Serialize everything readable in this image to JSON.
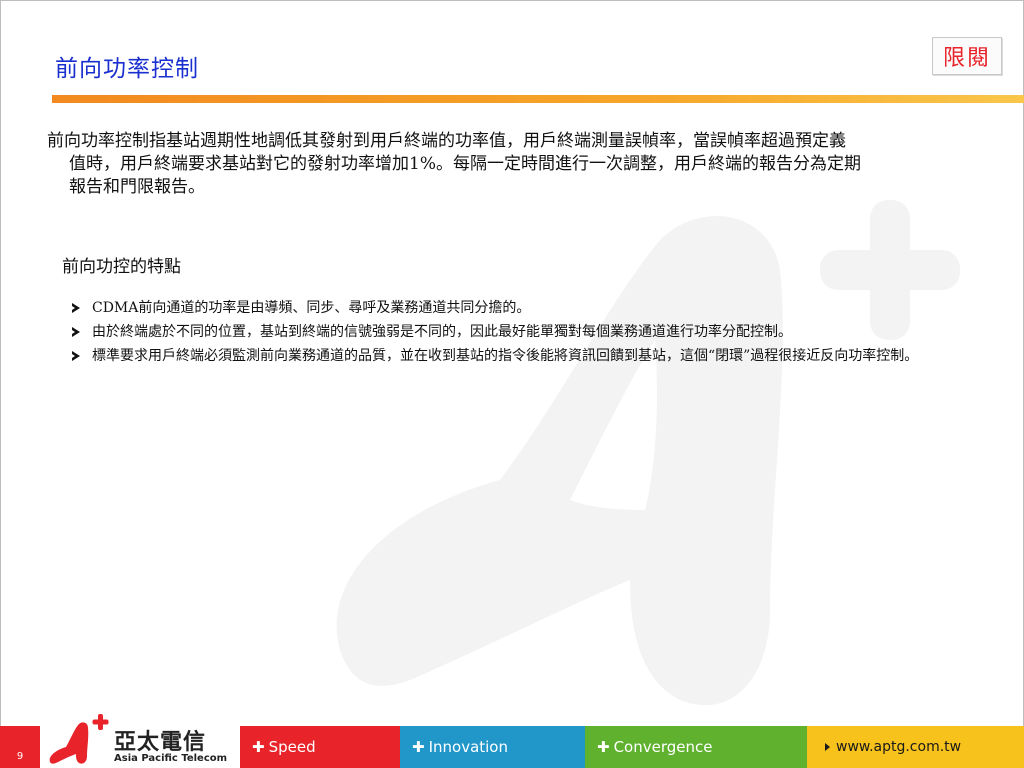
{
  "title": "前向功率控制",
  "badge": "限閱",
  "intro": {
    "lines": [
      "前向功率控制指基站週期性地調低其發射到用戶終端的功率值，用戶終端測量誤幀率，當誤幀率超過預定義",
      "值時，用戶終端要求基站對它的發射功率增加1%。每隔一定時間進行一次調整，用戶終端的報告分為定期",
      "報告和門限報告。"
    ]
  },
  "features": {
    "heading": "前向功控的特點",
    "bullets": [
      "CDMA前向通道的功率是由導頻、同步、尋呼及業務通道共同分擔的。",
      "由於終端處於不同的位置，基站到終端的信號強弱是不同的，因此最好能單獨對每個業務通道進行功率分配控制。",
      "標準要求用戶終端必須監測前向業務通道的品質，並在收到基站的指令後能將資訊回饋到基站，這個“閉環”過程很接近反向功率控制。"
    ]
  },
  "footer": {
    "page_number": "9",
    "logo_cn": "亞太電信",
    "logo_en": "Asia Pacific Telecom",
    "speed": "Speed",
    "innovation": "Innovation",
    "convergence": "Convergence",
    "website": "www.aptg.com.tw"
  },
  "colors": {
    "title": "#1a2fd0",
    "badge": "#e8232a",
    "rule": "#f6a52a",
    "speed": "#e8232a",
    "innovation": "#2196c8",
    "convergence": "#5fb12e",
    "website": "#f7c21b"
  }
}
